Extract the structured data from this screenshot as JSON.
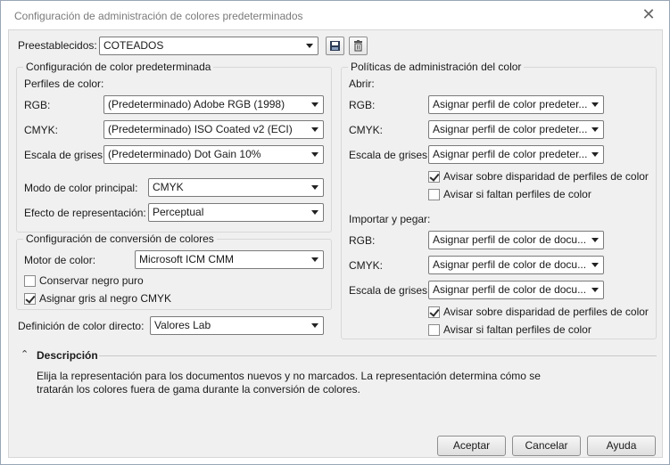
{
  "window": {
    "title": "Configuración de administración de colores predeterminados"
  },
  "presets": {
    "label": "Preestablecidos:",
    "value": "COTEADOS"
  },
  "default_color": {
    "title": "Configuración de color predeterminada",
    "profiles_label": "Perfiles de color:",
    "rgb_label": "RGB:",
    "rgb_value": "(Predeterminado) Adobe RGB (1998)",
    "cmyk_label": "CMYK:",
    "cmyk_value": "(Predeterminado) ISO Coated v2 (ECI)",
    "gray_label": "Escala de grises:",
    "gray_value": "(Predeterminado) Dot Gain 10%",
    "primary_mode_label": "Modo de color principal:",
    "primary_mode_value": "CMYK",
    "rendering_label": "Efecto de representación:",
    "rendering_value": "Perceptual"
  },
  "conversion": {
    "title": "Configuración de conversión de colores",
    "engine_label": "Motor de color:",
    "engine_value": "Microsoft ICM CMM",
    "preserve_black_label": "Conservar negro puro",
    "preserve_black_checked": false,
    "gray_to_black_label": "Asignar gris al negro CMYK",
    "gray_to_black_checked": true
  },
  "spot": {
    "label": "Definición de color directo:",
    "value": "Valores Lab"
  },
  "policies": {
    "title": "Políticas de administración del color",
    "open_label": "Abrir:",
    "open_rgb_label": "RGB:",
    "open_rgb_value": "Asignar perfil de color predeter...",
    "open_cmyk_label": "CMYK:",
    "open_cmyk_value": "Asignar perfil de color predeter...",
    "open_gray_label": "Escala de grises:",
    "open_gray_value": "Asignar perfil de color predeter...",
    "open_warn_mismatch_label": "Avisar sobre disparidad de perfiles de color",
    "open_warn_mismatch_checked": true,
    "open_warn_missing_label": "Avisar si faltan perfiles de color",
    "open_warn_missing_checked": false,
    "import_label": "Importar y pegar:",
    "import_rgb_label": "RGB:",
    "import_rgb_value": "Asignar perfil de color de docu...",
    "import_cmyk_label": "CMYK:",
    "import_cmyk_value": "Asignar perfil de color de docu...",
    "import_gray_label": "Escala de grises:",
    "import_gray_value": "Asignar perfil de color de docu...",
    "import_warn_mismatch_label": "Avisar sobre disparidad de perfiles de color",
    "import_warn_mismatch_checked": true,
    "import_warn_missing_label": "Avisar si faltan perfiles de color",
    "import_warn_missing_checked": false
  },
  "description": {
    "title": "Descripción",
    "line1": "Elija la representación para los documentos nuevos y no marcados. La representación determina cómo se",
    "line2": "tratarán los colores fuera de gama durante la conversión de colores."
  },
  "buttons": {
    "accept": "Aceptar",
    "cancel": "Cancelar",
    "help": "Ayuda"
  }
}
